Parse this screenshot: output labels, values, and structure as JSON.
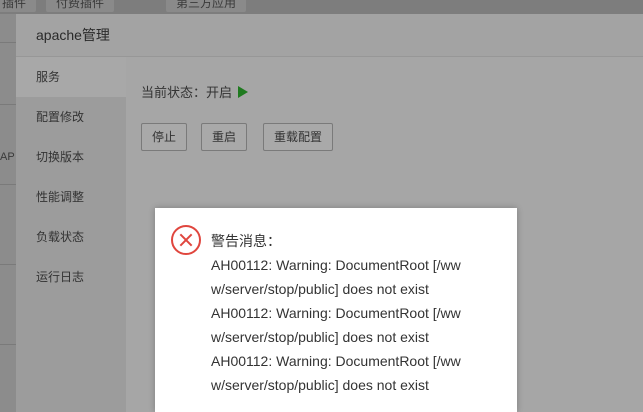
{
  "background": {
    "tabs": [
      "插件",
      "付费插件",
      "第三方应用"
    ],
    "left_fragment": "AP"
  },
  "panel": {
    "title": "apache管理",
    "sidebar": {
      "items": [
        {
          "label": "服务",
          "active": true
        },
        {
          "label": "配置修改"
        },
        {
          "label": "切换版本"
        },
        {
          "label": "性能调整"
        },
        {
          "label": "负载状态"
        },
        {
          "label": "运行日志"
        }
      ]
    },
    "status": {
      "text": "当前状态：开启"
    },
    "buttons": {
      "stop": "停止",
      "restart": "重启",
      "reload": "重载配置"
    }
  },
  "alert": {
    "icon": "error-circle-x-icon",
    "lines": [
      "警告消息：",
      "AH00112: Warning: DocumentRoot [/ww",
      "w/server/stop/public] does not exist",
      "AH00112: Warning: DocumentRoot [/ww",
      "w/server/stop/public] does not exist",
      "AH00112: Warning: DocumentRoot [/ww",
      "w/server/stop/public] does not exist"
    ]
  },
  "colors": {
    "overlay": "#7d7d7d",
    "error": "#e0463e",
    "running": "#1f7a1f"
  }
}
